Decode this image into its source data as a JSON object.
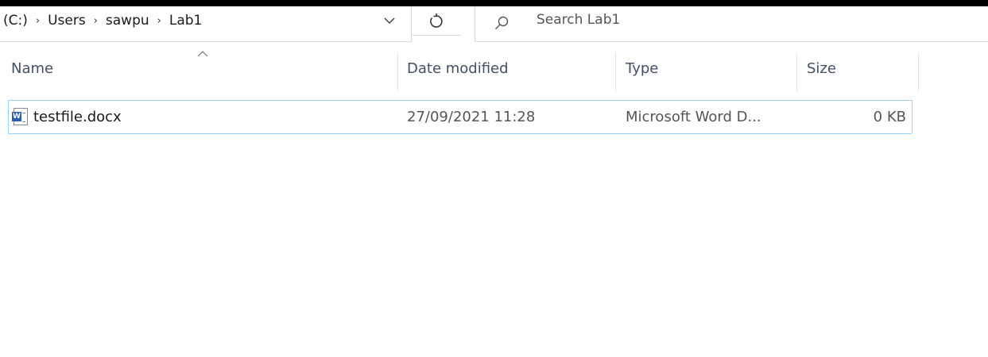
{
  "address_bar": {
    "breadcrumbs": [
      "(C:)",
      "Users",
      "sawpu",
      "Lab1"
    ],
    "separator": "›",
    "dropdown_icon": "chevron-down-icon",
    "refresh_icon": "refresh-icon"
  },
  "search": {
    "placeholder": "Search Lab1",
    "icon": "search-icon"
  },
  "columns": {
    "name": "Name",
    "date_modified": "Date modified",
    "type": "Type",
    "size": "Size",
    "sorted_by": "name",
    "sort_direction": "ascending"
  },
  "files": [
    {
      "name": "testfile.docx",
      "date_modified": "27/09/2021 11:28",
      "type": "Microsoft Word D...",
      "size": "0 KB",
      "icon": "word-document-icon",
      "icon_letter": "W"
    }
  ],
  "colors": {
    "header_text": "#434f66",
    "row_border": "#99d1ff",
    "word_blue": "#2b5cbb"
  }
}
